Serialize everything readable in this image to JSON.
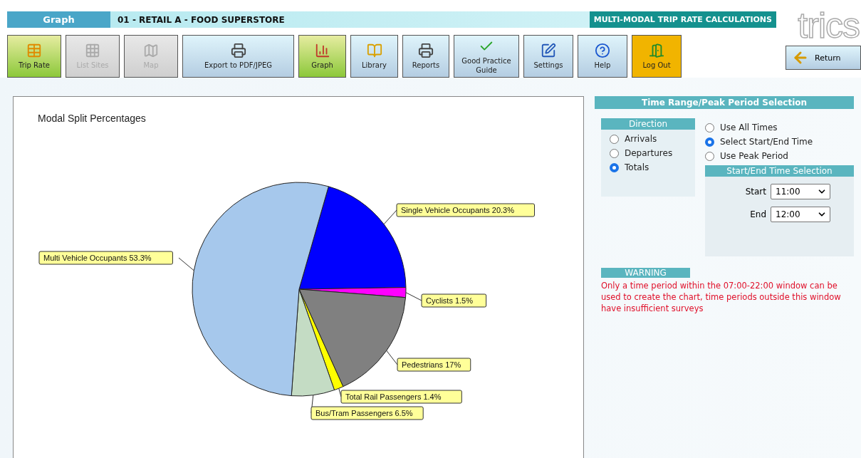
{
  "header": {
    "section": "Graph",
    "title": "01 - RETAIL A - FOOD SUPERSTORE",
    "banner": "MULTI-MODAL TRIP RATE CALCULATIONS",
    "logo": "trics"
  },
  "toolbar": [
    {
      "label": "Trip Rate",
      "kind": "active",
      "disabled": false
    },
    {
      "label": "List Sites",
      "kind": "normal",
      "disabled": true
    },
    {
      "label": "Map",
      "kind": "normal",
      "disabled": true
    },
    {
      "label": "Export to PDF/JPEG",
      "kind": "normal",
      "disabled": false
    },
    {
      "label": "Graph",
      "kind": "active",
      "disabled": false
    },
    {
      "label": "Library",
      "kind": "normal",
      "disabled": false
    },
    {
      "label": "Reports",
      "kind": "normal",
      "disabled": false
    },
    {
      "label": "Good Practice Guide",
      "kind": "normal",
      "disabled": false
    },
    {
      "label": "Settings",
      "kind": "normal",
      "disabled": false
    },
    {
      "label": "Help",
      "kind": "normal",
      "disabled": false
    },
    {
      "label": "Log Out",
      "kind": "warning",
      "disabled": false
    }
  ],
  "return_button": "Return",
  "chart": {
    "chart_data": {
      "type": "pie",
      "title": "Modal Split Percentages",
      "categories": [
        "Single Vehicle Occupants",
        "Cyclists",
        "Pedestrians",
        "Total Rail Passengers",
        "Bus/Tram Passengers",
        "Multi Vehicle Occupants"
      ],
      "values": [
        20.3,
        1.5,
        17,
        1.4,
        6.5,
        53.3
      ],
      "value_labels": [
        "20.3%",
        "1.5%",
        "17%",
        "1.4%",
        "6.5%",
        "53.3%"
      ]
    }
  },
  "time_panel": {
    "title": "Time Range/Peak Period Selection",
    "direction": {
      "title": "Direction",
      "options": [
        {
          "label": "Arrivals",
          "selected": false
        },
        {
          "label": "Departures",
          "selected": false
        },
        {
          "label": "Totals",
          "selected": true
        }
      ]
    },
    "modes": [
      {
        "label": "Use All Times",
        "selected": false
      },
      {
        "label": "Select Start/End Time",
        "selected": true
      },
      {
        "label": "Use Peak Period",
        "selected": false
      }
    ],
    "selection": {
      "title": "Start/End Time Selection",
      "fields": [
        {
          "label": "Start",
          "value": "11:00"
        },
        {
          "label": "End",
          "value": "12:00"
        }
      ]
    },
    "warning": {
      "title": "WARNING",
      "text": "Only a time period within the 07:00-22:00 window can be used to create the chart, time periods outside this window have insufficient surveys"
    }
  }
}
